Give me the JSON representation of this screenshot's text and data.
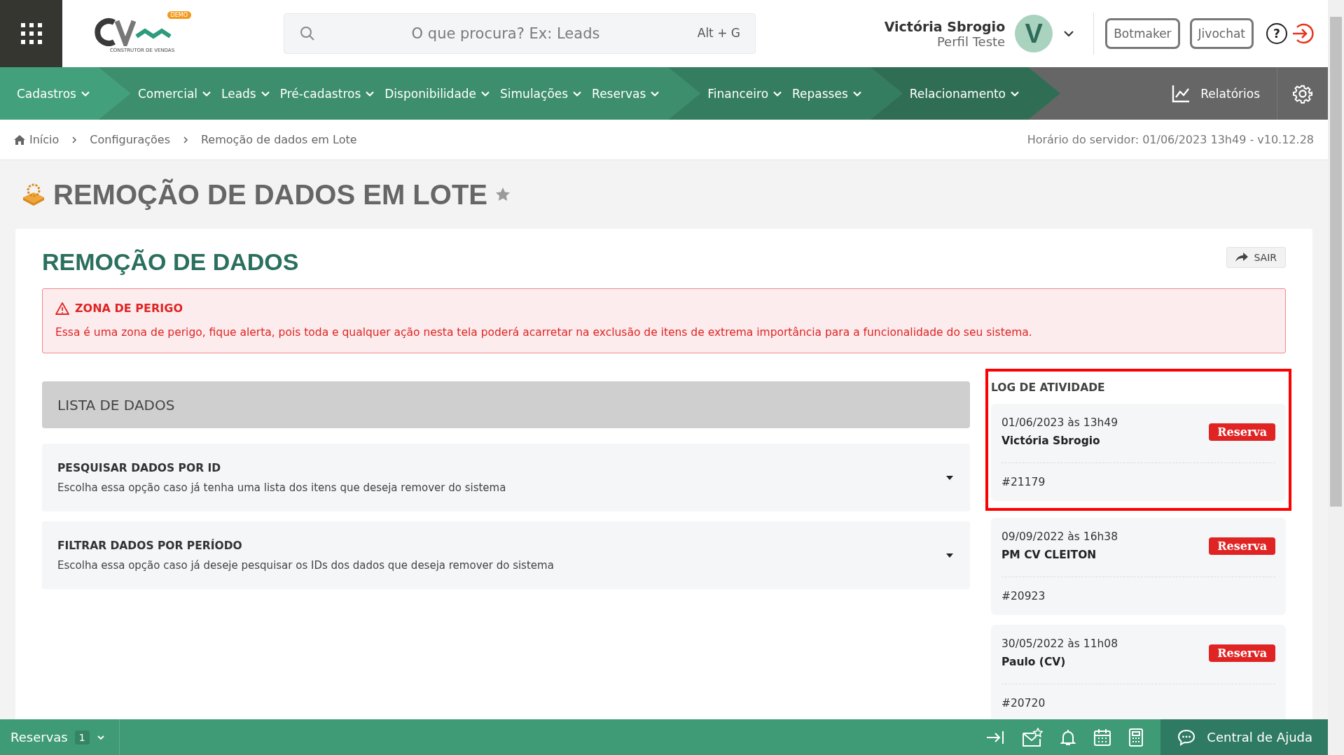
{
  "header": {
    "logo": {
      "badge": "DEMO",
      "tagline": "CONSTRUTOR DE VENDAS"
    },
    "search": {
      "placeholder": "O que procura? Ex: Leads",
      "shortcut": "Alt + G"
    },
    "user": {
      "name": "Victória Sbrogio",
      "profile": "Perfil Teste",
      "initial": "V"
    },
    "buttons": [
      "Botmaker",
      "Jivochat"
    ],
    "help": "?"
  },
  "nav": {
    "groups": [
      {
        "items": [
          "Cadastros"
        ]
      },
      {
        "items": [
          "Comercial",
          "Leads",
          "Pré-cadastros",
          "Disponibilidade",
          "Simulações",
          "Reservas"
        ]
      },
      {
        "items": [
          "Financeiro",
          "Repasses"
        ]
      },
      {
        "items": [
          "Relacionamento"
        ]
      }
    ],
    "reports": "Relatórios"
  },
  "breadcrumb": [
    "Início",
    "Configurações",
    "Remoção de dados em Lote"
  ],
  "server_time": "Horário do servidor: 01/06/2023 13h49 - v10.12.28",
  "page_title": "REMOÇÃO DE DADOS EM LOTE",
  "favorite": false,
  "card": {
    "title": "REMOÇÃO DE DADOS",
    "exit_button": "SAIR",
    "danger": {
      "title": "ZONA DE PERIGO",
      "text": "Essa é uma zona de perigo, fique alerta, pois toda e qualquer ação nesta tela poderá acarretar na exclusão de itens de extrema importância para a funcionalidade do seu sistema."
    },
    "list_header": "LISTA DE DADOS",
    "options": [
      {
        "title": "PESQUISAR DADOS POR ID",
        "description": "Escolha essa opção caso já tenha uma lista dos itens que deseja remover do sistema",
        "expanded": false
      },
      {
        "title": "FILTRAR DADOS POR PERÍODO",
        "description": "Escolha essa opção caso já deseje pesquisar os IDs dos dados que deseja remover do sistema",
        "expanded": false
      }
    ],
    "log": {
      "title": "LOG DE ATIVIDADE",
      "entries": [
        {
          "date": "01/06/2023 às 13h49",
          "user": "Victória Sbrogio",
          "tag": "Reserva",
          "id": "#21179",
          "highlighted": true
        },
        {
          "date": "09/09/2022 às 16h38",
          "user": "PM CV CLEITON",
          "tag": "Reserva",
          "id": "#20923",
          "highlighted": false
        },
        {
          "date": "30/05/2022 às 11h08",
          "user": "Paulo (CV)",
          "tag": "Reserva",
          "id": "#20720",
          "highlighted": false
        }
      ]
    }
  },
  "footer": {
    "label": "Reservas",
    "count": "1",
    "help": "Central de Ajuda"
  }
}
